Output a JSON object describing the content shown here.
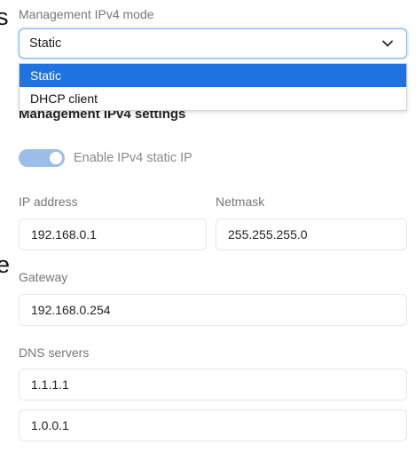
{
  "clipped_text": {
    "top": "s",
    "bottom": "e"
  },
  "mode": {
    "label": "Management IPv4 mode",
    "selected": "Static",
    "options": [
      "Static",
      "DHCP client"
    ]
  },
  "settings": {
    "title": "Management IPv4 settings",
    "toggle_label": "Enable IPv4 static IP",
    "toggle_on": true,
    "ip_address": {
      "label": "IP address",
      "value": "192.168.0.1"
    },
    "netmask": {
      "label": "Netmask",
      "value": "255.255.255.0"
    },
    "gateway": {
      "label": "Gateway",
      "value": "192.168.0.254"
    },
    "dns": {
      "label": "DNS servers",
      "values": [
        "1.1.1.1",
        "1.0.0.1"
      ]
    }
  },
  "colors": {
    "accent": "#1f73e0",
    "toggle_track": "#9bbfe8"
  },
  "icons": {
    "select_chevron": "chevron-down-icon"
  }
}
